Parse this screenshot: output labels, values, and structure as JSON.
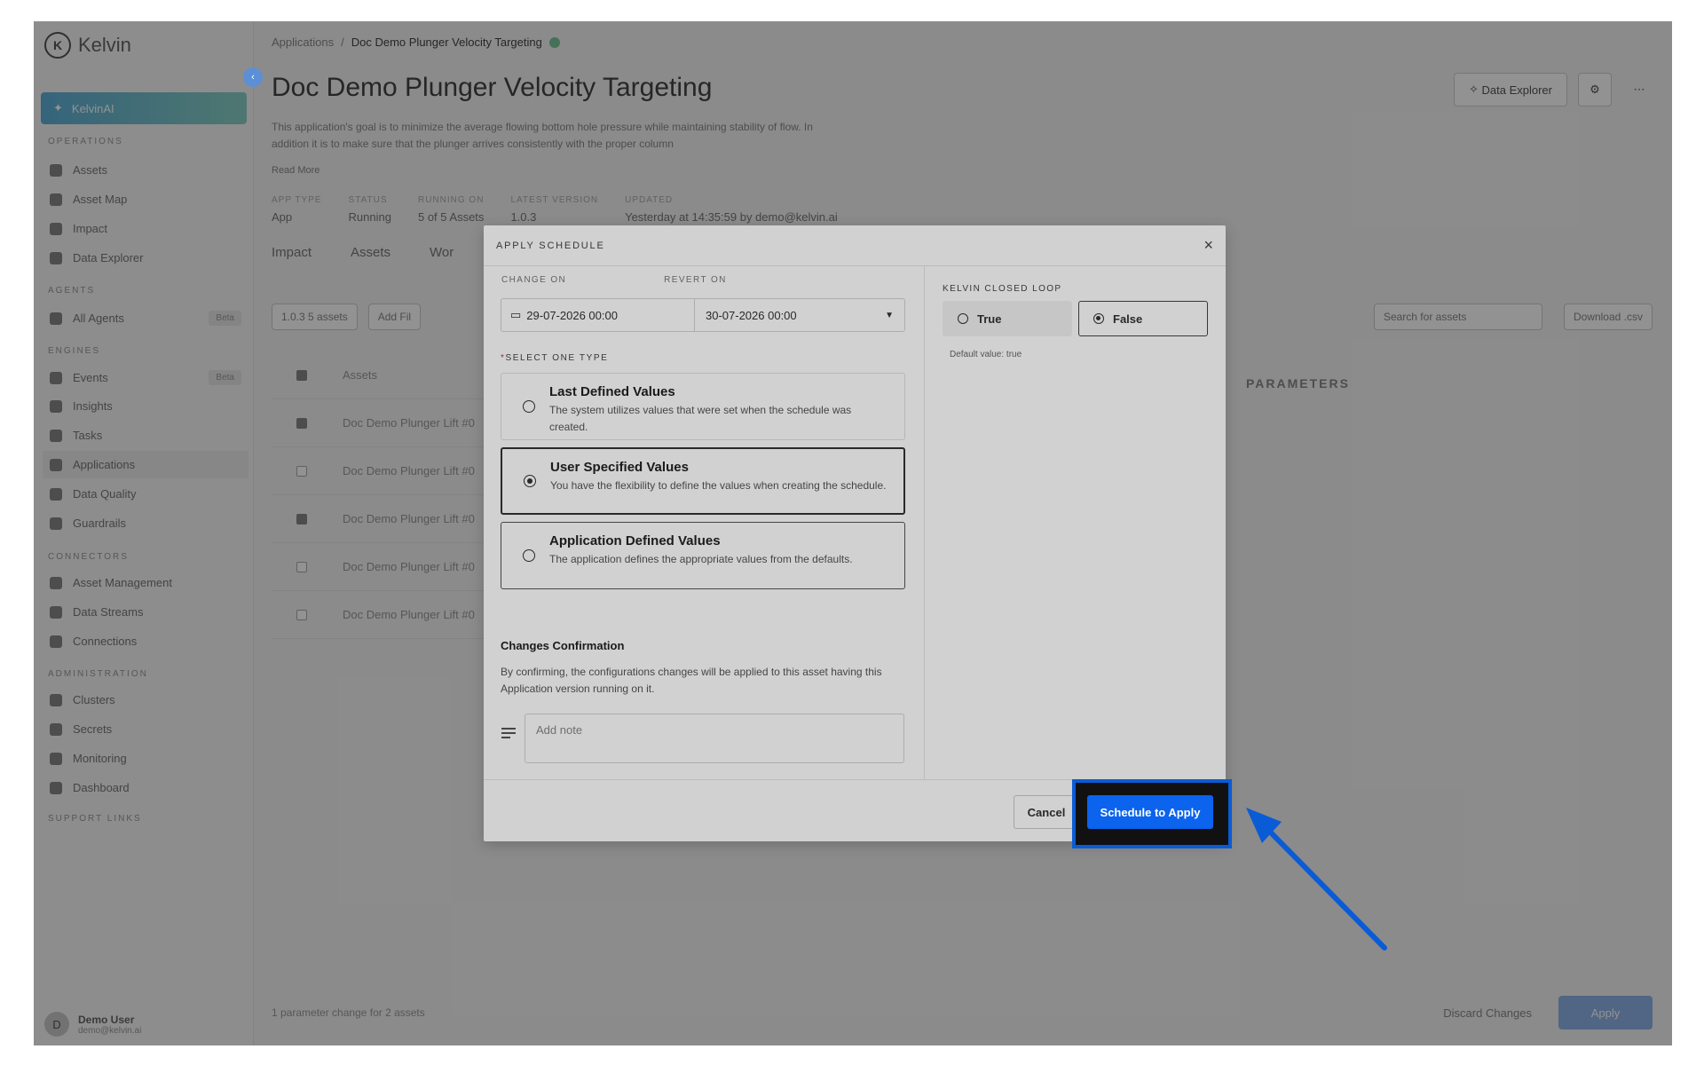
{
  "brand": {
    "name": "Kelvin",
    "logo_letter": "K"
  },
  "sidebar": {
    "ai_label": "KelvinAI",
    "sections": [
      {
        "label": "OPERATIONS",
        "items": [
          "Assets",
          "Asset Map",
          "Impact",
          "Data Explorer"
        ]
      },
      {
        "label": "AGENTS",
        "items": [
          "All Agents"
        ]
      },
      {
        "label": "ENGINES",
        "items": [
          "Events",
          "Insights",
          "Tasks",
          "Applications",
          "Data Quality",
          "Guardrails"
        ]
      },
      {
        "label": "CONNECTORS",
        "items": [
          "Asset Management",
          "Data Streams",
          "Connections"
        ]
      },
      {
        "label": "ADMINISTRATION",
        "items": [
          "Clusters",
          "Secrets",
          "Monitoring",
          "Dashboard"
        ]
      },
      {
        "label": "SUPPORT LINKS",
        "items": []
      }
    ],
    "tag_beta": "Beta",
    "user_name": "Demo User",
    "user_email": "demo@kelvin.ai",
    "user_initial": "D"
  },
  "page": {
    "breadcrumb_root": "Applications",
    "breadcrumb_sep": "/",
    "breadcrumb_current": "Doc Demo Plunger Velocity Targeting",
    "title": "Doc Demo Plunger Velocity Targeting",
    "description": "This application's goal is to minimize the average flowing bottom hole pressure while maintaining stability of flow. In addition it is to make sure that the plunger arrives consistently with the proper column",
    "read_more": "Read More",
    "meta": [
      {
        "k": "APP TYPE",
        "v": "App"
      },
      {
        "k": "STATUS",
        "v": "Running"
      },
      {
        "k": "RUNNING ON",
        "v": "5 of 5 Assets"
      },
      {
        "k": "LATEST VERSION",
        "v": "1.0.3"
      },
      {
        "k": "UPDATED",
        "v": "Yesterday at 14:35:59 by demo@kelvin.ai"
      }
    ],
    "data_explorer": "Data Explorer",
    "tabs": [
      "Impact",
      "Assets",
      "Wor"
    ],
    "version_chip": "1.0.3 5 assets",
    "add_filter": "Add Fil",
    "assets_header": "Assets",
    "rows": [
      "Doc Demo Plunger Lift #0",
      "Doc Demo Plunger Lift #0",
      "Doc Demo Plunger Lift #0",
      "Doc Demo Plunger Lift #0",
      "Doc Demo Plunger Lift #0"
    ],
    "search_placeholder": "Search for assets",
    "download": "Download .csv",
    "params_title": "PARAMETERS",
    "footer_msg": "1 parameter change for 2 assets",
    "discard": "Discard Changes",
    "apply": "Apply"
  },
  "modal": {
    "title": "APPLY SCHEDULE",
    "change_on_label": "CHANGE ON",
    "revert_on_label": "REVERT ON",
    "change_on": "29-07-2026 00:00",
    "revert_on": "30-07-2026 00:00",
    "type_label": "SELECT ONE TYPE",
    "options": [
      {
        "title": "Last Defined Values",
        "desc": "The system utilizes values that were set when the schedule was created."
      },
      {
        "title": "User Specified Values",
        "desc": "You have the flexibility to define the values when creating the schedule."
      },
      {
        "title": "Application Defined Values",
        "desc": "The application defines the appropriate values from the defaults."
      }
    ],
    "selected_option": "User Specified Values",
    "confirm_title": "Changes Confirmation",
    "confirm_desc": "By confirming, the configurations changes will be applied to this asset having this Application version running on it.",
    "note_placeholder": "Add note",
    "loop_label": "KELVIN CLOSED LOOP",
    "loop_true": "True",
    "loop_false": "False",
    "loop_selected": "False",
    "default_value": "Default value: true",
    "cancel": "Cancel",
    "schedule_btn": "Schedule to Apply"
  },
  "colors": {
    "primary": "#0b63ee",
    "highlight_border": "#0a5bd6",
    "arrow": "#0a5bd6"
  }
}
